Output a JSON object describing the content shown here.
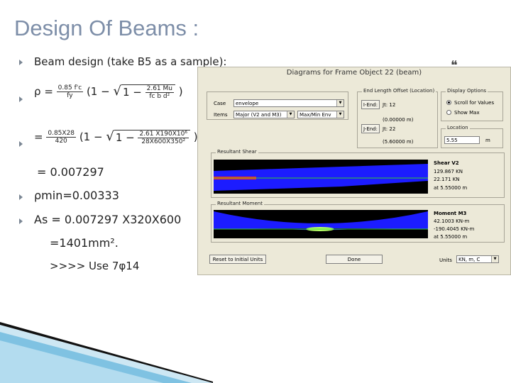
{
  "slide": {
    "title": "Design Of Beams :",
    "quote_mark": "❝",
    "bullets": [
      {
        "id": "b1",
        "text": "Beam design (take B5 as a sample):"
      },
      {
        "id": "b2",
        "rho_symbol": "ρ",
        "eq": "=",
        "frac_num": "0.85 f'c",
        "frac_den": "fy",
        "open": "(1 −",
        "sqrt_inner_num": "2.61 Mu",
        "sqrt_inner_den": "fc b d²",
        "close": ")"
      },
      {
        "id": "b3",
        "eq": "=",
        "frac_num": "0.85X28",
        "frac_den": "420",
        "open": "(1 −",
        "sqrt_inner_num": "2.61 X190X10⁶",
        "sqrt_inner_den": "28X600X350²",
        "close": ")"
      },
      {
        "id": "r1",
        "text": "= 0.007297"
      },
      {
        "id": "b4",
        "text": "ρmin=0.00333"
      },
      {
        "id": "b5",
        "text": "As = 0.007297 X320X600"
      },
      {
        "id": "r2",
        "text": "=1401mm²."
      },
      {
        "id": "r3",
        "text": ">>>> Use 7φ14"
      }
    ]
  },
  "dialog": {
    "title": "Diagrams for Frame Object 22  (beam)",
    "case_label": "Case",
    "case_value": "envelope",
    "items_label": "Items",
    "items_value": "Major (V2 and M3)",
    "env_value": "Max/Min Env",
    "end_offset_group": "End Length Offset (Location)",
    "i_end_button": "I-End:",
    "i_end_jt": "Jt: 12",
    "i_end_loc": "(0.00000 m)",
    "j_end_button": "J-End:",
    "j_end_jt": "Jt: 22",
    "j_end_loc": "(5.60000 m)",
    "display_group": "Display Options",
    "opt_scroll": "Scroll for Values",
    "opt_showmax": "Show Max",
    "location_label": "Location",
    "location_value": "5.55",
    "location_unit": "m",
    "shear_group": "Resultant Shear",
    "shear_title": "Shear V2",
    "shear_v1": "129.867 KN",
    "shear_v2": "22.171 KN",
    "shear_v3": "at 5.55000 m",
    "moment_group": "Resultant Moment",
    "moment_title": "Moment M3",
    "moment_v1": "42.1003 KN-m",
    "moment_v2": "-190.4045 KN-m",
    "moment_v3": "at 5.55000 m",
    "reset_button": "Reset to Initial Units",
    "done_button": "Done",
    "units_label": "Units",
    "units_value": "KN, m, C",
    "colors": {
      "plot_bg": "#000000",
      "envelope": "#1c1cff",
      "shear_min": "#ff2a2a",
      "zero_line": "#33cc33"
    }
  }
}
